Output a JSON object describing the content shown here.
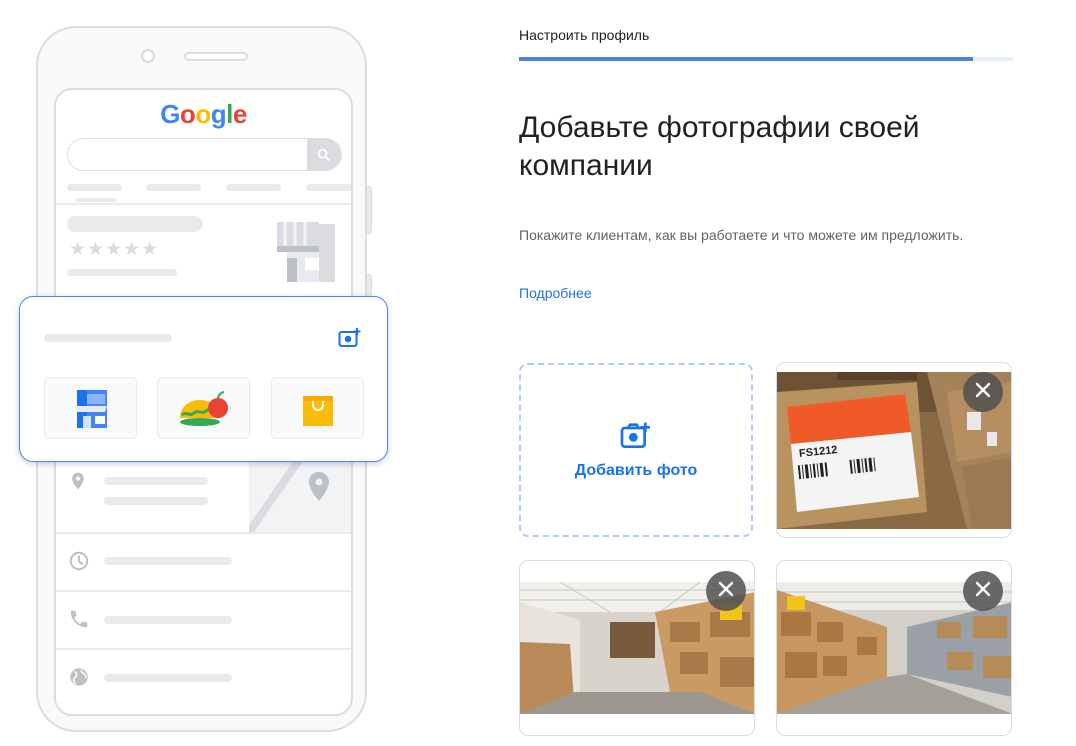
{
  "illustration": {
    "logo_letters": [
      {
        "char": "G",
        "color": "#4285F4"
      },
      {
        "char": "o",
        "color": "#EA4335"
      },
      {
        "char": "o",
        "color": "#FBBC05"
      },
      {
        "char": "g",
        "color": "#4285F4"
      },
      {
        "char": "l",
        "color": "#34A853"
      },
      {
        "char": "e",
        "color": "#EA4335"
      }
    ],
    "stars": "★★★★★",
    "card_icon": "add-photo-icon",
    "thumb_icons": [
      "storefront-icon",
      "food-icon",
      "shopping-bag-icon"
    ],
    "row_icons": [
      "location-pin-icon",
      "clock-icon",
      "phone-icon",
      "globe-icon"
    ]
  },
  "header": {
    "step_label": "Настроить профиль",
    "progress_fraction": 0.92
  },
  "main": {
    "title": "Добавьте фотографии своей компании",
    "description": "Покажите клиентам, как вы работаете и что можете им предложить.",
    "learn_more": "Подробнее",
    "add_photo_label": "Добавить фото",
    "photos": [
      {
        "name": "warehouse-boxes-label",
        "box_label": "FS1212"
      },
      {
        "name": "warehouse-aisle-1"
      },
      {
        "name": "warehouse-aisle-2"
      }
    ]
  },
  "colors": {
    "accent": "#1a73e8",
    "progress": "#4a84e0",
    "card_border": "#4285f4"
  }
}
